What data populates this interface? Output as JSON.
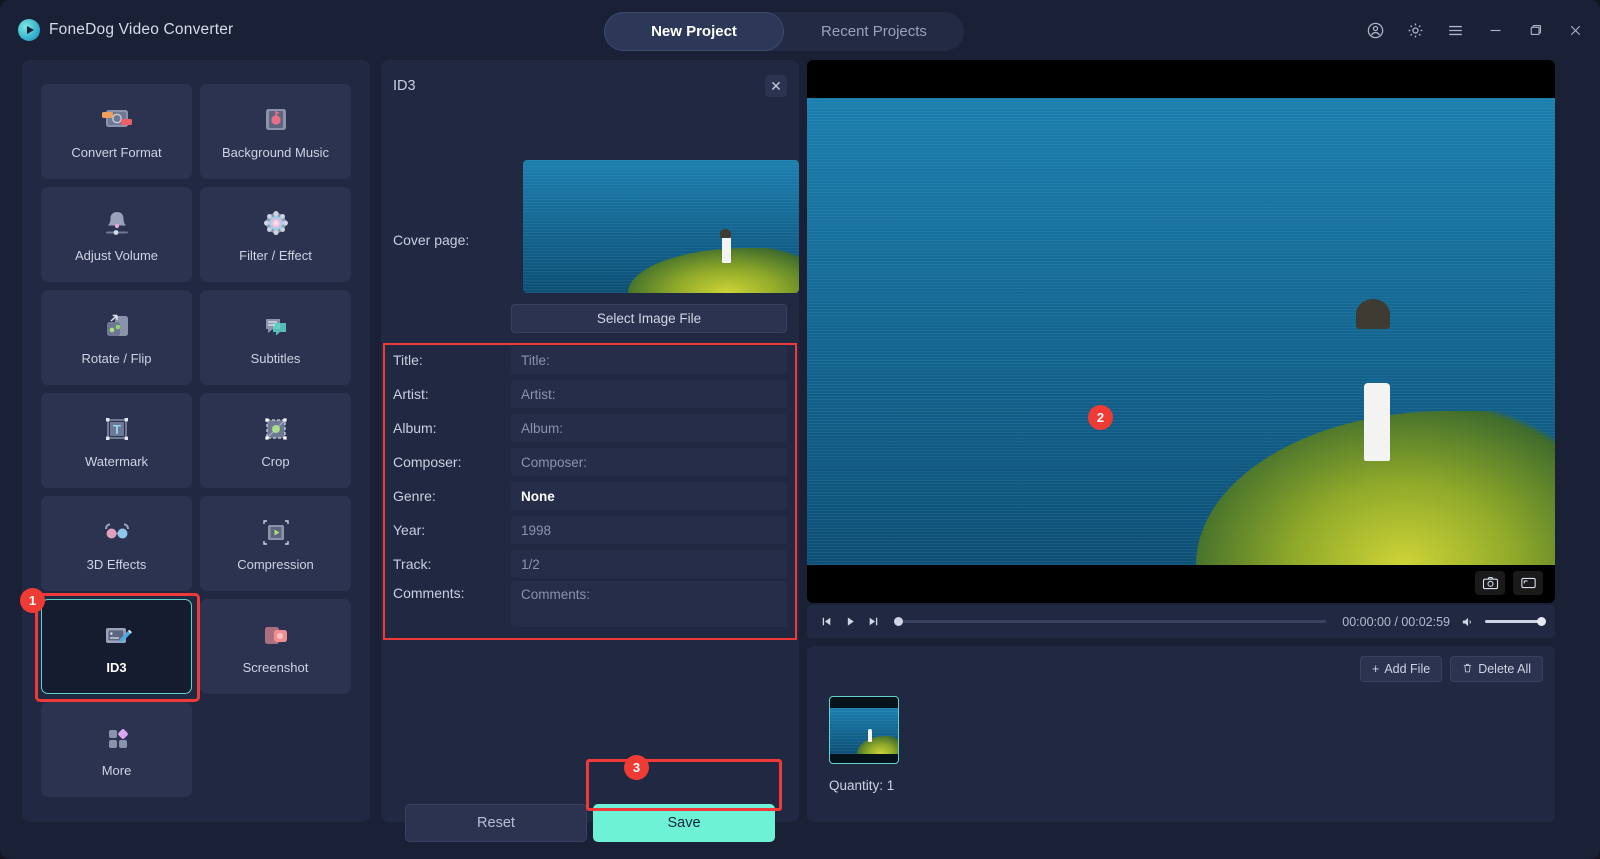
{
  "app": {
    "brand": "FoneDog Video Converter",
    "logo_icon": "play-circle-icon"
  },
  "titlebar": {
    "tabs": [
      {
        "label": "New Project",
        "active": true
      },
      {
        "label": "Recent Projects",
        "active": false
      }
    ],
    "window_icons": [
      "account-icon",
      "gear-icon",
      "menu-icon",
      "minimize-icon",
      "maximize-icon",
      "close-icon"
    ]
  },
  "sidebar": {
    "tools": [
      {
        "label": "Convert Format",
        "icon": "convert-format-icon"
      },
      {
        "label": "Background Music",
        "icon": "background-music-icon"
      },
      {
        "label": "Adjust Volume",
        "icon": "adjust-volume-icon"
      },
      {
        "label": "Filter / Effect",
        "icon": "filter-effect-icon"
      },
      {
        "label": "Rotate / Flip",
        "icon": "rotate-flip-icon"
      },
      {
        "label": "Subtitles",
        "icon": "subtitles-icon"
      },
      {
        "label": "Watermark",
        "icon": "watermark-icon"
      },
      {
        "label": "Crop",
        "icon": "crop-icon"
      },
      {
        "label": "3D Effects",
        "icon": "3d-effects-icon"
      },
      {
        "label": "Compression",
        "icon": "compression-icon"
      },
      {
        "label": "ID3",
        "icon": "id3-icon",
        "selected": true,
        "badge": "1"
      },
      {
        "label": "Screenshot",
        "icon": "screenshot-icon"
      },
      {
        "label": "More",
        "icon": "more-icon"
      }
    ]
  },
  "id3_panel": {
    "title": "ID3",
    "close_icon": "close-icon",
    "cover_label": "Cover page:",
    "select_image_label": "Select Image File",
    "fields_badge": "2",
    "fields": [
      {
        "label": "Title:",
        "placeholder": "Title:",
        "value": "",
        "type": "text"
      },
      {
        "label": "Artist:",
        "placeholder": "Artist:",
        "value": "",
        "type": "text"
      },
      {
        "label": "Album:",
        "placeholder": "Album:",
        "value": "",
        "type": "text"
      },
      {
        "label": "Composer:",
        "placeholder": "Composer:",
        "value": "",
        "type": "text"
      },
      {
        "label": "Genre:",
        "placeholder": "None",
        "value": "None",
        "type": "select"
      },
      {
        "label": "Year:",
        "placeholder": "1998",
        "value": "",
        "type": "text"
      },
      {
        "label": "Track:",
        "placeholder": "1/2",
        "value": "",
        "type": "text"
      },
      {
        "label": "Comments:",
        "placeholder": "Comments:",
        "value": "",
        "type": "textarea"
      }
    ],
    "reset_label": "Reset",
    "save_label": "Save",
    "save_badge": "3"
  },
  "preview": {
    "snapshot_icon": "camera-icon",
    "fullscreen_icon": "expand-icon"
  },
  "player": {
    "prev_icon": "skip-previous-icon",
    "play_icon": "play-icon",
    "next_icon": "skip-next-icon",
    "timecode": "00:00:00 / 00:02:59",
    "volume_icon": "volume-icon"
  },
  "filelist": {
    "add_file_label": "Add File",
    "add_file_icon": "plus-icon",
    "delete_all_label": "Delete All",
    "delete_all_icon": "trash-icon",
    "quantity": "Quantity: 1"
  },
  "colors": {
    "accent_mint": "#6ef2d6",
    "annotation_red": "#f03a3a",
    "badge_red": "#ef3b33",
    "panel_bg": "#212942",
    "window_bg": "#1a2036",
    "tile_bg": "#2b3350"
  }
}
